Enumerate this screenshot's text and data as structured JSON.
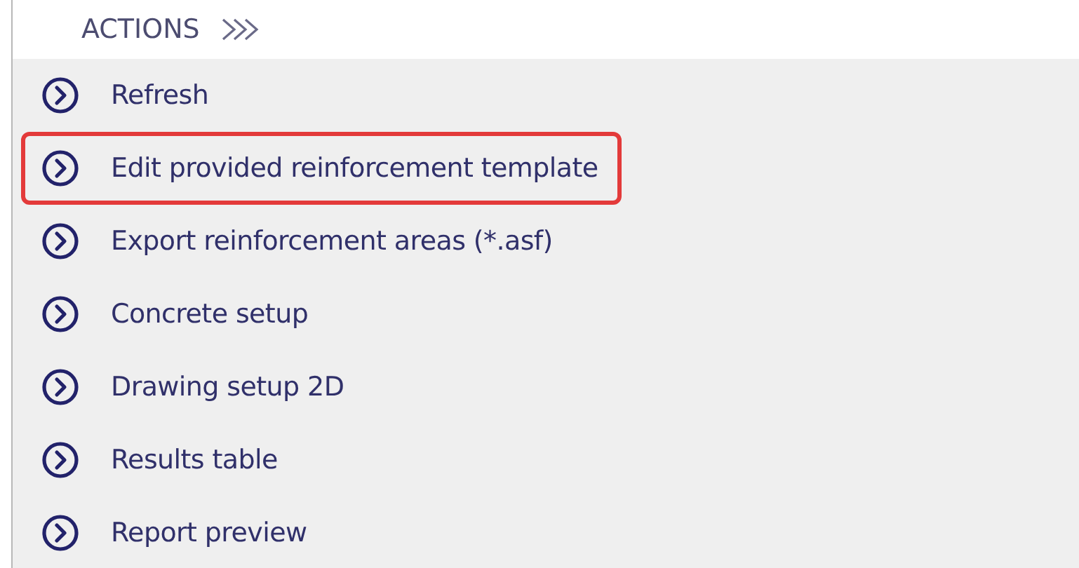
{
  "panel": {
    "title": "ACTIONS"
  },
  "actions": [
    {
      "label": "Refresh",
      "highlighted": false
    },
    {
      "label": "Edit provided reinforcement template",
      "highlighted": true
    },
    {
      "label": "Export reinforcement areas (*.asf)",
      "highlighted": false
    },
    {
      "label": "Concrete setup",
      "highlighted": false
    },
    {
      "label": "Drawing setup 2D",
      "highlighted": false
    },
    {
      "label": "Results table",
      "highlighted": false
    },
    {
      "label": "Report preview",
      "highlighted": false
    }
  ]
}
